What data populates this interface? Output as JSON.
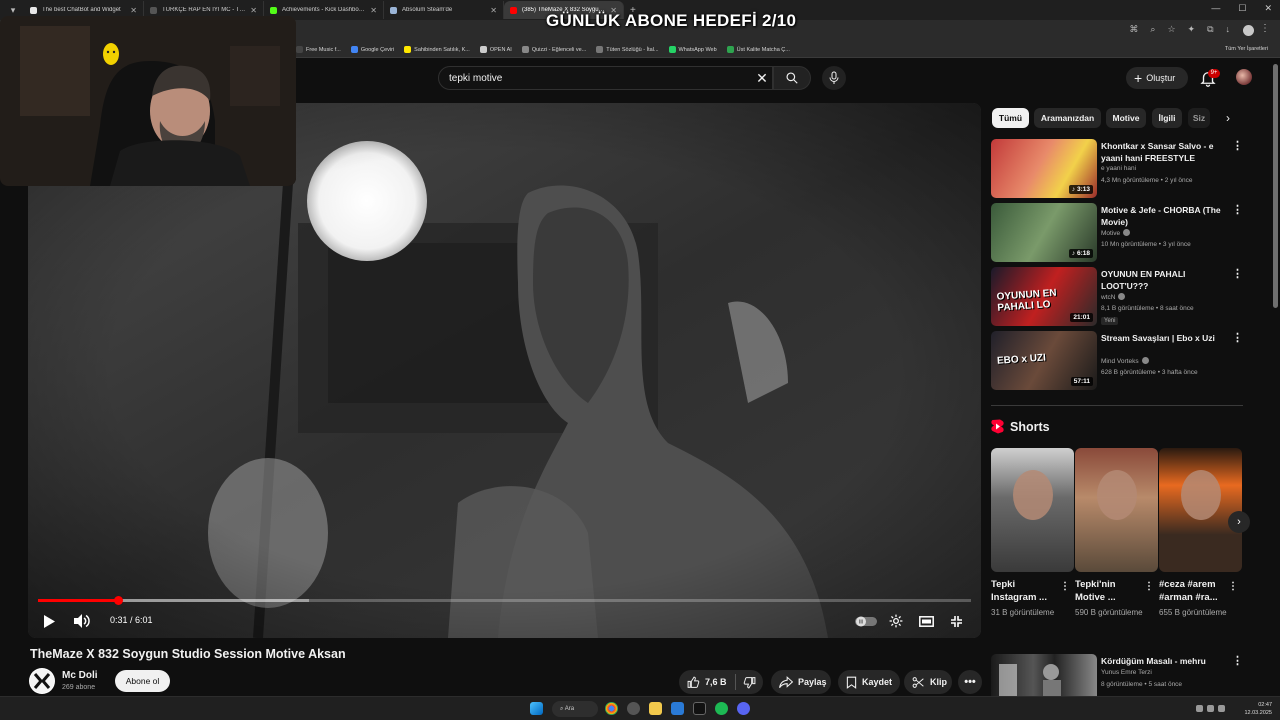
{
  "browser": {
    "tabs": [
      {
        "label": "The best ChatBot and Widget",
        "color": "#e8e8e8"
      },
      {
        "label": "TÜRKÇE RAP EN İYİ MC - Tier l",
        "color": "#555555"
      },
      {
        "label": "Achievements - Kick Dashboard",
        "color": "#53fc18"
      },
      {
        "label": "Absolum Steam'de",
        "color": "#9ab4d6"
      },
      {
        "label": "(385) TheMaze X 832 Soygun S",
        "color": "#ff0000",
        "active": true
      }
    ],
    "bookmarks": [
      {
        "label": "Free Music f...",
        "color": "#444444"
      },
      {
        "label": "Google Çeviri",
        "color": "#4285f4"
      },
      {
        "label": "Sahibinden Satılık, K...",
        "color": "#ffe800"
      },
      {
        "label": "OPEN AI",
        "color": "#cccccc"
      },
      {
        "label": "Quizzi - Eğlenceli ve...",
        "color": "#888888"
      },
      {
        "label": "Tüten Sözlüğü - İtal...",
        "color": "#777777"
      },
      {
        "label": "WhatsApp Web",
        "color": "#25d366"
      },
      {
        "label": "Üst Kalite Matcha Ç...",
        "color": "#2ea44f"
      }
    ],
    "all_bookmarks_label": "Tüm Yer İşaretleri"
  },
  "overlay": {
    "goal_text": "GÜNLÜK ABONE HEDEFİ 2/10"
  },
  "masthead": {
    "search_value": "tepki motive",
    "create_label": "Oluştur",
    "notification_count": "9+"
  },
  "player": {
    "progress_played": 0.086,
    "progress_buffered": 0.29,
    "time_current": "0:31",
    "time_total": "6:01"
  },
  "video": {
    "title": "TheMaze X 832 Soygun Studio Session Motive Aksan",
    "channel_name": "Mc Doli",
    "channel_subs": "269 abone",
    "subscribe_label": "Abone ol",
    "like_count": "7,6 B",
    "share_label": "Paylaş",
    "save_label": "Kaydet",
    "clip_label": "Klip"
  },
  "chips": [
    {
      "label": "Tümü",
      "active": true
    },
    {
      "label": "Aramanızdan",
      "active": false
    },
    {
      "label": "Motive",
      "active": false
    },
    {
      "label": "İlgili",
      "active": false
    },
    {
      "label": "Siz",
      "active": false
    }
  ],
  "recommendations": [
    {
      "title": "Khontkar x Sansar Salvo - e yaani hani FREESTYLE",
      "channel": "e yaani hani",
      "verified": false,
      "meta": "4,3 Mn görüntüleme • 2 yıl önce",
      "duration": "3:13",
      "music": true
    },
    {
      "title": "Motive & Jefe - CHORBA (The Movie)",
      "channel": "Motive",
      "verified": true,
      "meta": "10 Mn görüntüleme • 3 yıl önce",
      "duration": "6:18",
      "music": true
    },
    {
      "title": "OYUNUN EN PAHALI LOOT'U???",
      "channel": "wtcN",
      "verified": true,
      "meta": "8,1 B görüntüleme • 8 saat önce",
      "duration": "21:01",
      "music": false,
      "badge": "Yeni",
      "thumb_text": "OYUNUN EN PAHALI LO"
    },
    {
      "title": "Stream Savaşları | Ebo x Uzi",
      "channel": "Mind Vorteks",
      "verified": true,
      "meta": "628 B görüntüleme • 3 hafta önce",
      "duration": "57:11",
      "music": false,
      "thumb_text": "EBO x UZI"
    }
  ],
  "shorts": {
    "heading": "Shorts",
    "items": [
      {
        "title": "Tepki Instagram ...",
        "views": "31 B görüntüleme"
      },
      {
        "title": "Tepki'nin Motive ...",
        "views": "590 B görüntüleme"
      },
      {
        "title": "#ceza #arem #arman #ra...",
        "views": "655 B görüntüleme"
      }
    ]
  },
  "next_rec": {
    "title": "Kördüğüm Masalı - mehru",
    "channel": "Yunus Emre Terzi",
    "meta": "8 görüntüleme • 5 saat önce"
  },
  "taskbar": {
    "search_label": "Ara",
    "time": "02:47",
    "date": "12.03.2025"
  },
  "colors": {
    "accent_red": "#ff0000",
    "background": "#0f0f0f",
    "pill": "#272727"
  }
}
